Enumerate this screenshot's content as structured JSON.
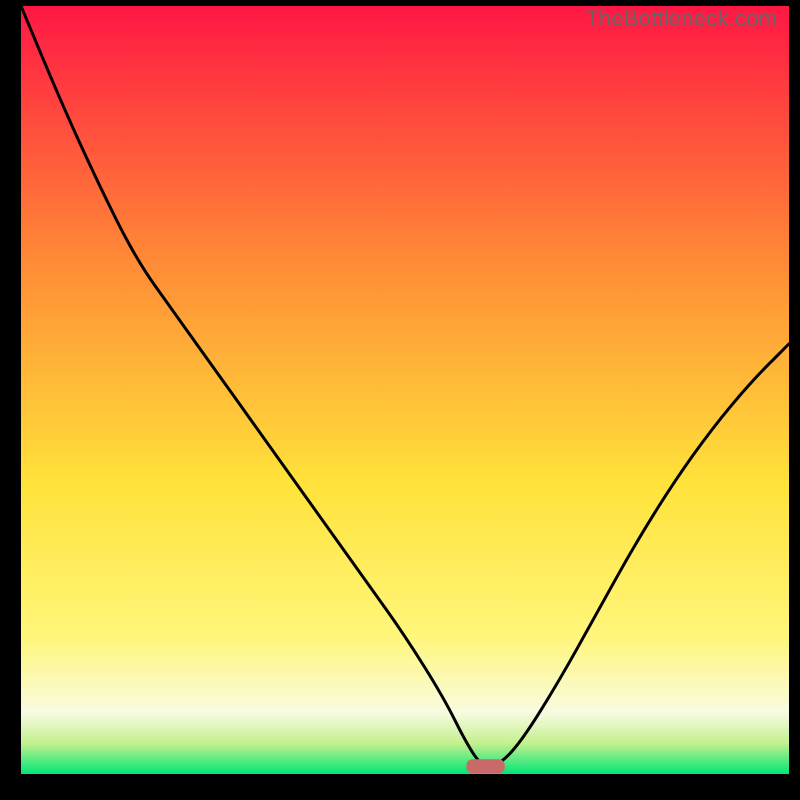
{
  "watermark": "TheBottleneck.com",
  "colors": {
    "gradient_top": "#ff1744",
    "gradient_mid1": "#ff8a36",
    "gradient_mid2": "#ffe23a",
    "gradient_mid3": "#fff67a",
    "gradient_bottom": "#f8fbe0",
    "green_band_top": "#c3f08e",
    "green_band_bottom": "#00e676",
    "curve": "#000000",
    "marker_fill": "#c96a6a"
  },
  "chart_data": {
    "type": "line",
    "title": "",
    "xlabel": "",
    "ylabel": "",
    "xlim": [
      0,
      100
    ],
    "ylim": [
      0,
      100
    ],
    "series": [
      {
        "name": "bottleneck-curve",
        "x": [
          0,
          5,
          10,
          15,
          20,
          25,
          30,
          35,
          40,
          45,
          50,
          55,
          58,
          60,
          62,
          65,
          70,
          75,
          80,
          85,
          90,
          95,
          100
        ],
        "y": [
          100,
          88,
          77,
          67,
          60,
          53,
          46,
          39,
          32,
          25,
          18,
          10,
          4,
          1,
          1,
          4,
          12,
          21,
          30,
          38,
          45,
          51,
          56
        ]
      }
    ],
    "marker": {
      "x_start": 58,
      "x_end": 63,
      "y": 1
    }
  }
}
